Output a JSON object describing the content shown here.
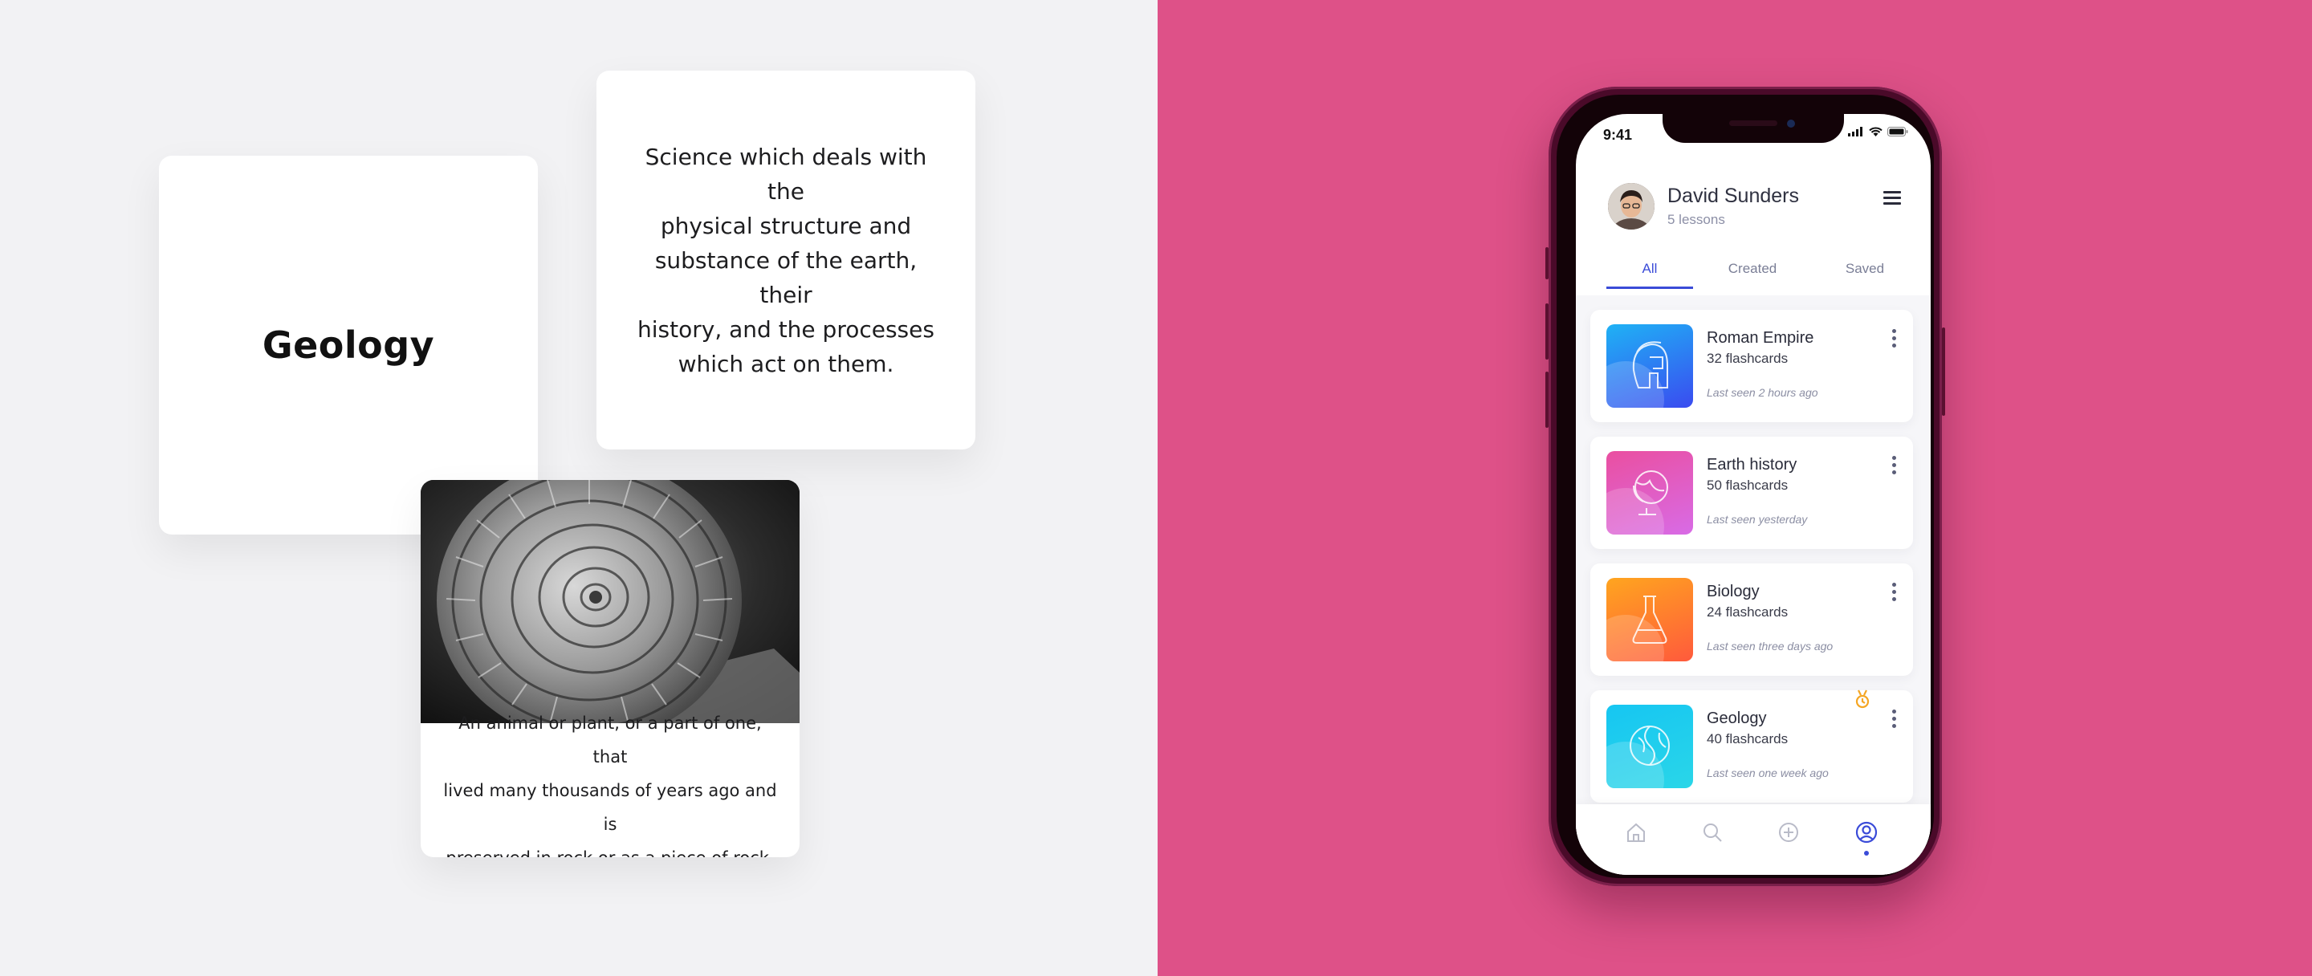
{
  "flashcards": {
    "term": "Geology",
    "definition_lines": [
      "Science which deals with the",
      "physical structure and",
      "substance of the earth, their",
      "history, and the processes",
      "which act on them."
    ],
    "image_caption_lines": [
      "An animal or plant, or a part of one, that",
      "lived many thousands of years ago and is",
      "preserved in rock or as a piece of rock."
    ]
  },
  "colors": {
    "left_background": "#f2f2f4",
    "right_background": "#de5188",
    "accent": "#3a4bd8"
  },
  "phone": {
    "status": {
      "time": "9:41"
    },
    "profile": {
      "name": "David Sunders",
      "lessons": "5 lessons"
    },
    "tabs": [
      {
        "label": "All",
        "active": true
      },
      {
        "label": "Created",
        "active": false
      },
      {
        "label": "Saved",
        "active": false
      }
    ],
    "decks": [
      {
        "title": "Roman Empire",
        "count": "32 flashcards",
        "last_seen": "Last seen 2 hours ago",
        "icon": "helmet-icon",
        "gradient": [
          "#1fb2f5",
          "#3a4bf0"
        ]
      },
      {
        "title": "Earth history",
        "count": "50 flashcards",
        "last_seen": "Last seen yesterday",
        "icon": "globe-icon",
        "gradient": [
          "#ea4fa0",
          "#d86be6"
        ]
      },
      {
        "title": "Biology",
        "count": "24 flashcards",
        "last_seen": "Last seen three days ago",
        "icon": "flask-icon",
        "gradient": [
          "#ffa51f",
          "#ff5a3c"
        ]
      },
      {
        "title": "Geology",
        "count": "40 flashcards",
        "last_seen": "Last seen one week ago",
        "icon": "globe-wire-icon",
        "gradient": [
          "#16c6f2",
          "#2ad6e8"
        ],
        "badge": "medal-icon"
      }
    ],
    "bottom_nav": [
      "home-icon",
      "search-icon",
      "add-icon",
      "profile-icon"
    ]
  }
}
